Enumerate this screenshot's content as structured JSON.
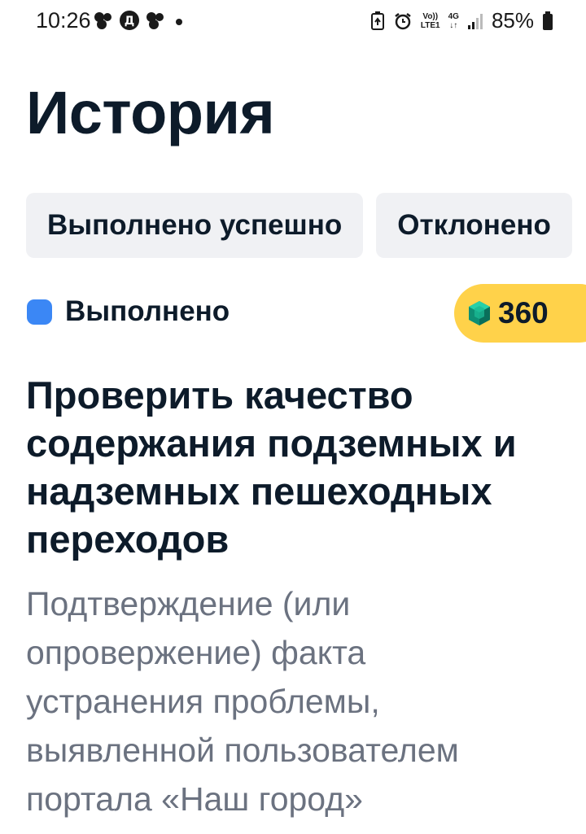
{
  "status_bar": {
    "time": "10:26",
    "battery": "85%",
    "network_top": "Vo))",
    "network_bottom": "LTE1",
    "network_type": "4G",
    "left_icons": [
      "messenger-icon",
      "vk-icon",
      "messenger-icon",
      "dot-icon"
    ],
    "right_icons": [
      "battery-saver-icon",
      "alarm-icon",
      "signal-icon",
      "battery-icon"
    ]
  },
  "page": {
    "title": "История"
  },
  "filters": [
    {
      "label": "Выполнено успешно",
      "selected": false
    },
    {
      "label": "Отклонено",
      "selected": false
    }
  ],
  "task": {
    "status": "Выполнено",
    "status_color": "#3b87f5",
    "reward": "360",
    "reward_icon": "gem-icon",
    "reward_color": "#ffd24a",
    "title": "Проверить качество содержания подземных и надземных пешеходных переходов",
    "description": "Подтверждение (или опровержение) факта устранения проблемы, выявленной пользователем портала «Наш город»"
  }
}
